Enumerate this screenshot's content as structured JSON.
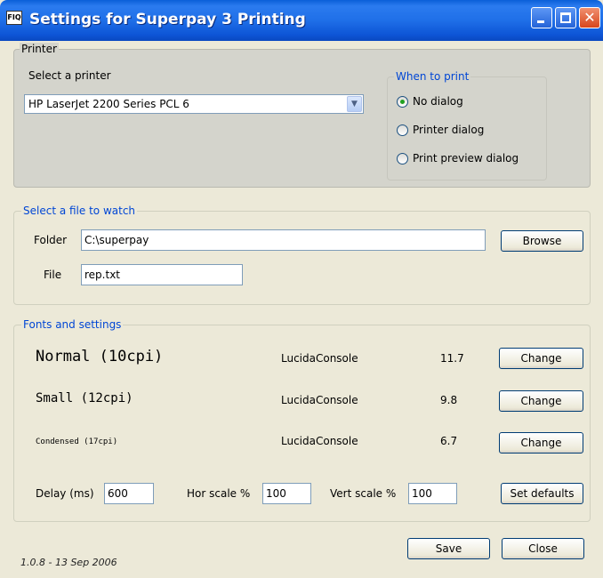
{
  "window": {
    "title": "Settings for Superpay 3 Printing",
    "icon": "app-icon",
    "app_icon_text": "FIQ"
  },
  "printer": {
    "group_title": "Printer",
    "select_label": "Select a printer",
    "selected_printer": "HP LaserJet 2200 Series PCL 6",
    "when_to_print": {
      "title": "When to print",
      "options": [
        "No dialog",
        "Printer dialog",
        "Print preview dialog"
      ],
      "selected": "No dialog"
    }
  },
  "watch": {
    "group_title": "Select a file to watch",
    "folder_label": "Folder",
    "folder_value": "C:\\superpay",
    "browse_label": "Browse",
    "file_label": "File",
    "file_value": "rep.txt"
  },
  "fonts": {
    "group_title": "Fonts and settings",
    "rows": [
      {
        "name": "Normal (10cpi)",
        "font": "LucidaConsole",
        "size": "11.7",
        "button": "Change"
      },
      {
        "name": "Small (12cpi)",
        "font": "LucidaConsole",
        "size": "9.8",
        "button": "Change"
      },
      {
        "name": "Condensed (17cpi)",
        "font": "LucidaConsole",
        "size": "6.7",
        "button": "Change"
      }
    ],
    "delay_label": "Delay (ms)",
    "delay_value": "600",
    "hor_label": "Hor scale %",
    "hor_value": "100",
    "vert_label": "Vert scale %",
    "vert_value": "100",
    "defaults_label": "Set defaults"
  },
  "footer": {
    "version": "1.0.8 - 13 Sep 2006",
    "save_label": "Save",
    "close_label": "Close"
  },
  "colors": {
    "title_bar": "#1f6fe8",
    "group_title_blue": "#0046d5",
    "window_bg": "#ece9d8",
    "radio_dot": "#21a121"
  }
}
